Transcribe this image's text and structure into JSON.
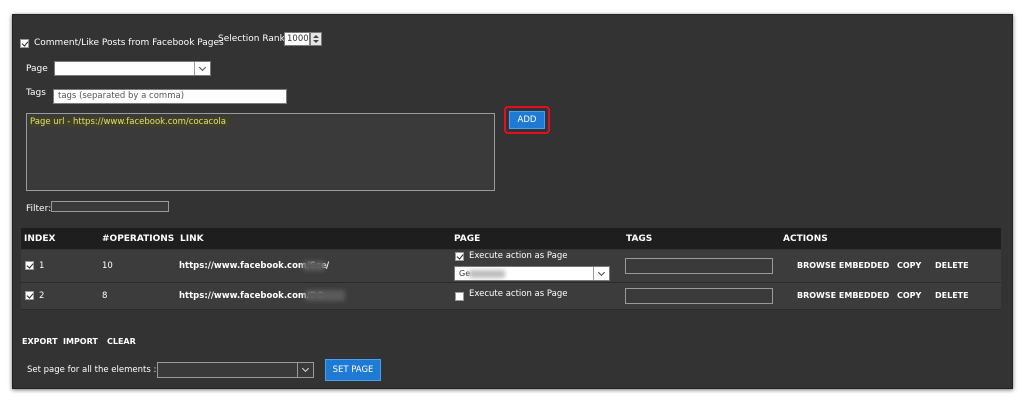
{
  "options": {
    "comment_like_label": "Comment/Like Posts from Facebook Pages",
    "selection_rank_label": "Selection Rank",
    "selection_rank_value": "1000",
    "page_label": "Page",
    "tags_label": "Tags",
    "tags_placeholder": "tags (separated by a comma)",
    "page_url_text": "Page url - https://www.facebook.com/cocacola",
    "add_button": "ADD",
    "filter_label": "Filter:"
  },
  "table": {
    "headers": [
      "INDEX",
      "#OPERATIONS",
      "LINK",
      "PAGE",
      "TAGS",
      "ACTIONS"
    ],
    "rows": [
      {
        "index": "1",
        "operations": "10",
        "link": "https://www.facebook.com/Sce",
        "link_suffix": "/",
        "execute_label": "Execute action as Page",
        "execute_checked": true,
        "page_select": "Ge",
        "actions": [
          "BROWSE EMBEDDED",
          "COPY",
          "DELETE"
        ]
      },
      {
        "index": "2",
        "operations": "8",
        "link": "https://www.facebook.com/DO",
        "link_suffix": "",
        "execute_label": "Execute action as Page",
        "execute_checked": false,
        "actions": [
          "BROWSE EMBEDDED",
          "COPY",
          "DELETE"
        ]
      }
    ]
  },
  "footer": {
    "export": "EXPORT",
    "import": "IMPORT",
    "clear": "CLEAR",
    "set_page_label": "Set page for all the elements :",
    "set_page_button": "SET PAGE"
  },
  "colors": {
    "panel_bg": "#333333",
    "header_bg": "#1e1e1e",
    "button_blue": "#1f7ad6",
    "highlight_red": "#e01020",
    "url_text": "#e3e06a"
  }
}
